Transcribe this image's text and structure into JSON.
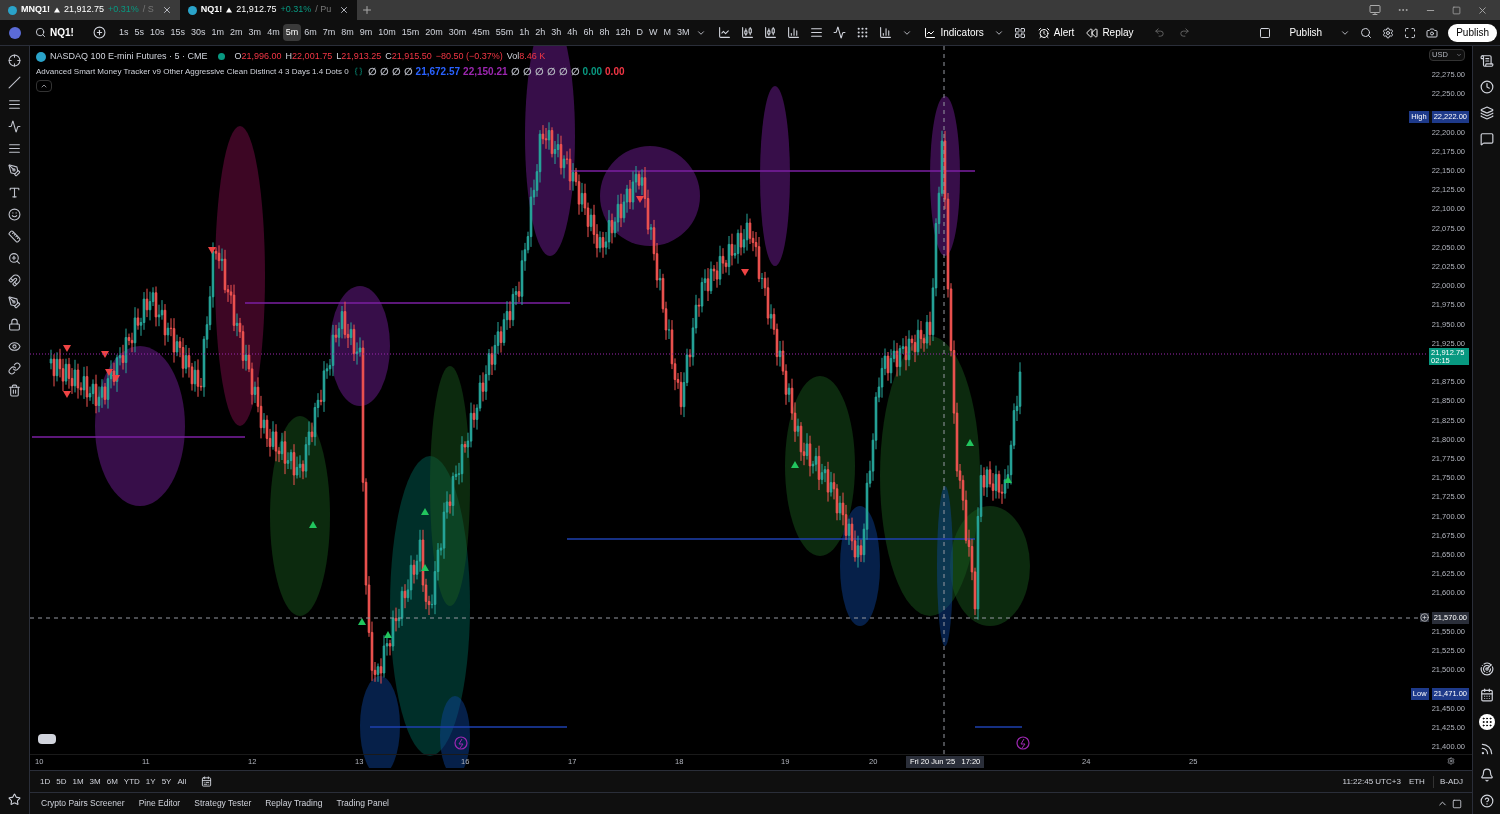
{
  "browser_tabs": [
    {
      "symbol": "MNQ1!",
      "price": "21,912.75",
      "change": "+0.31%",
      "suffix": "/ S",
      "selected": false
    },
    {
      "symbol": "NQ1!",
      "price": "21,912.75",
      "change": "+0.31%",
      "suffix": "/ Pu",
      "selected": true
    }
  ],
  "toolbar": {
    "symbol": "NQ1!",
    "intervals": [
      {
        "label": "1s",
        "selected": false
      },
      {
        "label": "5s",
        "selected": false
      },
      {
        "label": "10s",
        "selected": false
      },
      {
        "label": "15s",
        "selected": false
      },
      {
        "label": "30s",
        "selected": false
      },
      {
        "label": "1m",
        "selected": false
      },
      {
        "label": "2m",
        "selected": false
      },
      {
        "label": "3m",
        "selected": false
      },
      {
        "label": "4m",
        "selected": false
      },
      {
        "label": "5m",
        "selected": true
      },
      {
        "label": "6m",
        "selected": false
      },
      {
        "label": "7m",
        "selected": false
      },
      {
        "label": "8m",
        "selected": false
      },
      {
        "label": "9m",
        "selected": false
      },
      {
        "label": "10m",
        "selected": false
      },
      {
        "label": "15m",
        "selected": false
      },
      {
        "label": "20m",
        "selected": false
      },
      {
        "label": "30m",
        "selected": false
      },
      {
        "label": "45m",
        "selected": false
      },
      {
        "label": "55m",
        "selected": false
      },
      {
        "label": "1h",
        "selected": false
      },
      {
        "label": "2h",
        "selected": false
      },
      {
        "label": "3h",
        "selected": false
      },
      {
        "label": "4h",
        "selected": false
      },
      {
        "label": "6h",
        "selected": false
      },
      {
        "label": "8h",
        "selected": false
      },
      {
        "label": "12h",
        "selected": false
      },
      {
        "label": "D",
        "selected": false
      },
      {
        "label": "W",
        "selected": false
      },
      {
        "label": "M",
        "selected": false
      },
      {
        "label": "3M",
        "selected": false
      }
    ],
    "indicators": "Indicators",
    "alert": "Alert",
    "replay": "Replay",
    "publish_menu": "Publish",
    "publish_button": "Publish"
  },
  "legend": {
    "title": "NASDAQ 100 E-mini Futures · 5 · CME",
    "ohlc": [
      {
        "label": "O",
        "value": "21,996.00"
      },
      {
        "label": "H",
        "value": "22,001.75"
      },
      {
        "label": "L",
        "value": "21,913.25"
      },
      {
        "label": "C",
        "value": "21,915.50"
      }
    ],
    "change": "−80.50 (−0.37%)",
    "volume_label": "Vol",
    "volume": "8.46 K",
    "indicator_name": "Advanced Smart Money Tracker v9 Other Aggressive Clean Distinct 4 3 Days 1.4 Dots 0",
    "indicator_values": [
      {
        "text": "∅",
        "color": "#b2b5be"
      },
      {
        "text": "∅",
        "color": "#b2b5be"
      },
      {
        "text": "∅",
        "color": "#b2b5be"
      },
      {
        "text": "∅",
        "color": "#b2b5be"
      },
      {
        "text": "21,672.57",
        "color": "#2962ff"
      },
      {
        "text": "22,150.21",
        "color": "#9c27b0"
      },
      {
        "text": "∅",
        "color": "#b2b5be"
      },
      {
        "text": "∅",
        "color": "#b2b5be"
      },
      {
        "text": "∅",
        "color": "#b2b5be"
      },
      {
        "text": "∅",
        "color": "#b2b5be"
      },
      {
        "text": "∅",
        "color": "#b2b5be"
      },
      {
        "text": "∅",
        "color": "#b2b5be"
      },
      {
        "text": "0.00",
        "color": "#089981"
      },
      {
        "text": "0.00",
        "color": "#f23645"
      }
    ]
  },
  "price_axis": {
    "currency": "USD",
    "ticks": [
      "22,275.00",
      "22,250.00",
      "22,200.00",
      "22,175.00",
      "22,150.00",
      "22,125.00",
      "22,100.00",
      "22,075.00",
      "22,050.00",
      "22,025.00",
      "22,000.00",
      "21,975.00",
      "21,950.00",
      "21,925.00",
      "21,875.00",
      "21,850.00",
      "21,825.00",
      "21,800.00",
      "21,775.00",
      "21,750.00",
      "21,725.00",
      "21,700.00",
      "21,675.00",
      "21,650.00",
      "21,625.00",
      "21,600.00",
      "21,550.00",
      "21,525.00",
      "21,500.00",
      "21,450.00",
      "21,425.00",
      "21,400.00"
    ],
    "high_label": "High",
    "high": "22,222.00",
    "last": "21,912.75",
    "countdown": "02:15",
    "crosshair": "21,570.00",
    "low_label": "Low",
    "low": "21,471.00"
  },
  "time_axis": {
    "labels": [
      "10",
      "11",
      "12",
      "13",
      "16",
      "17",
      "18",
      "19",
      "20",
      "24",
      "25"
    ],
    "crosshair": "Fri 20 Jun '25   17:20"
  },
  "range_bar": {
    "ranges": [
      "1D",
      "5D",
      "1M",
      "3M",
      "6M",
      "YTD",
      "1Y",
      "5Y",
      "All"
    ],
    "time": "11:22:45 UTC+3",
    "session": "ETH",
    "adjust": "B-ADJ"
  },
  "bottom_tabs": [
    "Crypto Pairs Screener",
    "Pine Editor",
    "Strategy Tester",
    "Replay Trading",
    "Trading Panel"
  ]
}
